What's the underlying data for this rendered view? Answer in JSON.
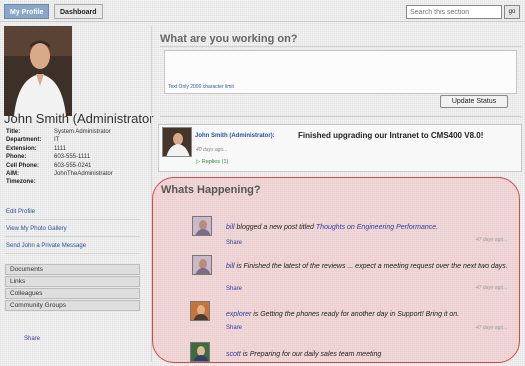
{
  "tabs": {
    "active": "My Profile",
    "inactive": "Dashboard"
  },
  "search": {
    "placeholder": "Search this section",
    "go": "go"
  },
  "profile": {
    "name": "John Smith (Administrator",
    "fields": [
      {
        "key": "Title:",
        "value": "System Administrator"
      },
      {
        "key": "Department:",
        "value": "IT"
      },
      {
        "key": "Extension:",
        "value": "1111"
      },
      {
        "key": "Phone:",
        "value": "603-555-1111"
      },
      {
        "key": "Cell Phone:",
        "value": "603-555-0241"
      },
      {
        "key": "AIM:",
        "value": "JohnTheAdministrator"
      },
      {
        "key": "Timezone:",
        "value": ""
      }
    ],
    "links": {
      "edit": "Edit Profile",
      "gallery": "View My Photo Gallery",
      "message": "Send John a Private Message"
    }
  },
  "sidenav": [
    "Documents",
    "Links",
    "Colleagues",
    "Community Groups"
  ],
  "share_left": "Share",
  "working": {
    "title": "What are you working on?",
    "char_limit": "Text Only 2000 character limit",
    "update_button": "Update Status"
  },
  "status": {
    "user": "John Smith (Administrator):",
    "text": "Finished upgrading our Intranet to CMS400 V8.0!",
    "time": "40 days ago...",
    "replies": "Replies (1)"
  },
  "happening": {
    "title": "Whats Happening?",
    "items": [
      {
        "user": "bill",
        "text": " blogged a new post titled ",
        "link": "Thoughts on Engineering Performance.",
        "share": "Share",
        "time": "47 days ago..."
      },
      {
        "user": "bill",
        "text": " is Finished the latest of the reviews ... expect a meeting request over the next two days.",
        "link": "",
        "share": "Share",
        "time": "47 days ago..."
      },
      {
        "user": "explorer",
        "text": " is Getting the phones ready for another day in Support! Bring it on.",
        "link": "",
        "share": "Share",
        "time": "47 days ago..."
      },
      {
        "user": "scott",
        "text": " is Preparing for our daily sales team meeting",
        "link": "",
        "share": "",
        "time": ""
      }
    ]
  },
  "colors": {
    "accent": "#8aa6c8",
    "link": "#2c3ea8",
    "highlight_border": "#d84646",
    "highlight_fill": "#f0b2b2"
  },
  "icons": [
    "profile-photo",
    "reply-arrow-icon"
  ]
}
